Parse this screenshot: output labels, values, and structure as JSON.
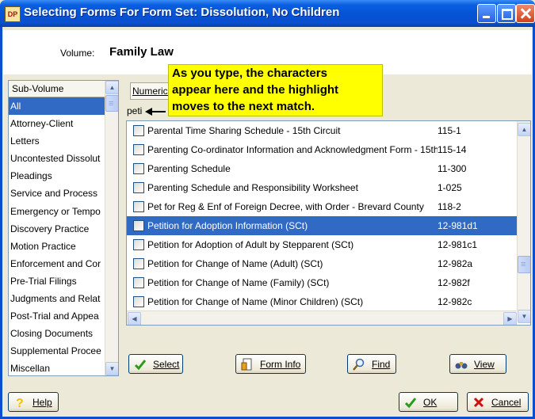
{
  "window": {
    "app_icon_text": "DP",
    "title": "Selecting Forms For Form Set: Dissolution, No Children"
  },
  "volume": {
    "label": "Volume:",
    "value": "Family Law"
  },
  "subvolume": {
    "header": "Sub-Volume",
    "items": [
      {
        "label": "All"
      },
      {
        "label": "Attorney-Client"
      },
      {
        "label": "Letters"
      },
      {
        "label": "Uncontested Dissolut"
      },
      {
        "label": "Pleadings"
      },
      {
        "label": "Service and Process"
      },
      {
        "label": "Emergency or Tempo"
      },
      {
        "label": "Discovery Practice"
      },
      {
        "label": "Motion Practice"
      },
      {
        "label": "Enforcement and Cor"
      },
      {
        "label": "Pre-Trial Filings"
      },
      {
        "label": "Judgments and Relat"
      },
      {
        "label": "Post-Trial and Appea"
      },
      {
        "label": "Closing Documents"
      },
      {
        "label": "Supplemental Procee"
      },
      {
        "label": "Miscellan"
      }
    ]
  },
  "tabs": {
    "numerical": "Numerical"
  },
  "search": {
    "typed": "peti"
  },
  "callout": {
    "line1": "As you type, the characters",
    "line2": "appear here and the highlight",
    "line3": "moves to the next match."
  },
  "forms": [
    {
      "name": "Parental Time Sharing Schedule - 15th Circuit",
      "code": "115-1"
    },
    {
      "name": "Parenting Co-ordinator Information and Acknowledgment Form - 15th",
      "code": "115-14"
    },
    {
      "name": "Parenting Schedule",
      "code": "11-300"
    },
    {
      "name": "Parenting Schedule and Responsibility Worksheet",
      "code": "1-025"
    },
    {
      "name": "Pet for Reg & Enf of Foreign Decree, with Order - Brevard County",
      "code": "118-2"
    },
    {
      "name": "Petition for Adoption Information (SCt)",
      "code": "12-981d1"
    },
    {
      "name": "Petition for Adoption of Adult by Stepparent (SCt)",
      "code": "12-981c1"
    },
    {
      "name": "Petition for Change of Name (Adult) (SCt)",
      "code": "12-982a"
    },
    {
      "name": "Petition for Change of Name (Family) (SCt)",
      "code": "12-982f"
    },
    {
      "name": "Petition for Change of Name (Minor Children) (SCt)",
      "code": "12-982c"
    }
  ],
  "buttons": {
    "select": "Select",
    "form_info": "Form Info",
    "find": "Find",
    "view": "View",
    "help": "Help",
    "ok": "OK",
    "cancel": "Cancel"
  },
  "colors": {
    "title_bar": "#0554d6",
    "selection": "#316ac5",
    "callout": "#ffff00"
  }
}
